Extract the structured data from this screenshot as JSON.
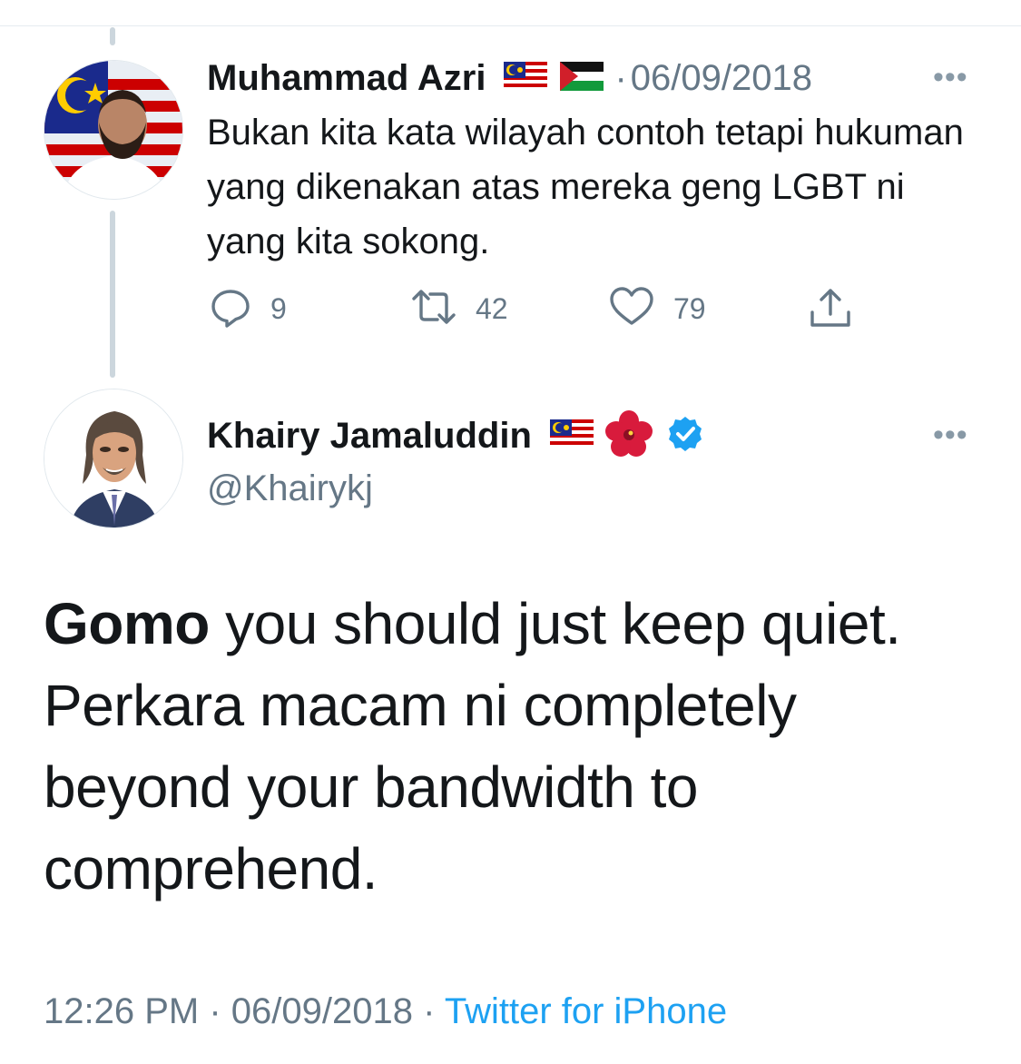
{
  "reply": {
    "author_name": "Muhammad Azri",
    "separator": "·",
    "date": "06/09/2018",
    "text": "Bukan kita kata wilayah contoh tetapi hukuman yang dikenakan atas mereka geng LGBT ni yang kita sokong.",
    "icons": [
      "malaysia-flag-icon",
      "palestine-flag-icon",
      "more-icon",
      "reply-icon",
      "retweet-icon",
      "like-icon",
      "share-icon"
    ],
    "actions": {
      "replies": "9",
      "retweets": "42",
      "likes": "79"
    }
  },
  "main_tweet": {
    "author_name": "Khairy Jamaluddin",
    "handle": "@Khairykj",
    "icons": [
      "malaysia-flag-icon",
      "hibiscus-icon",
      "verified-badge-icon",
      "more-icon"
    ],
    "text_bold": "Gomo",
    "text_rest": " you should just keep quiet. Perkara macam ni completely beyond your bandwidth to comprehend.",
    "time": "12:26 PM",
    "separator": "·",
    "date": "06/09/2018",
    "source": "Twitter for iPhone"
  },
  "colors": {
    "accent": "#1da1f2",
    "muted": "#657786",
    "text": "#14171a",
    "thread_line": "#ccd6dd"
  }
}
